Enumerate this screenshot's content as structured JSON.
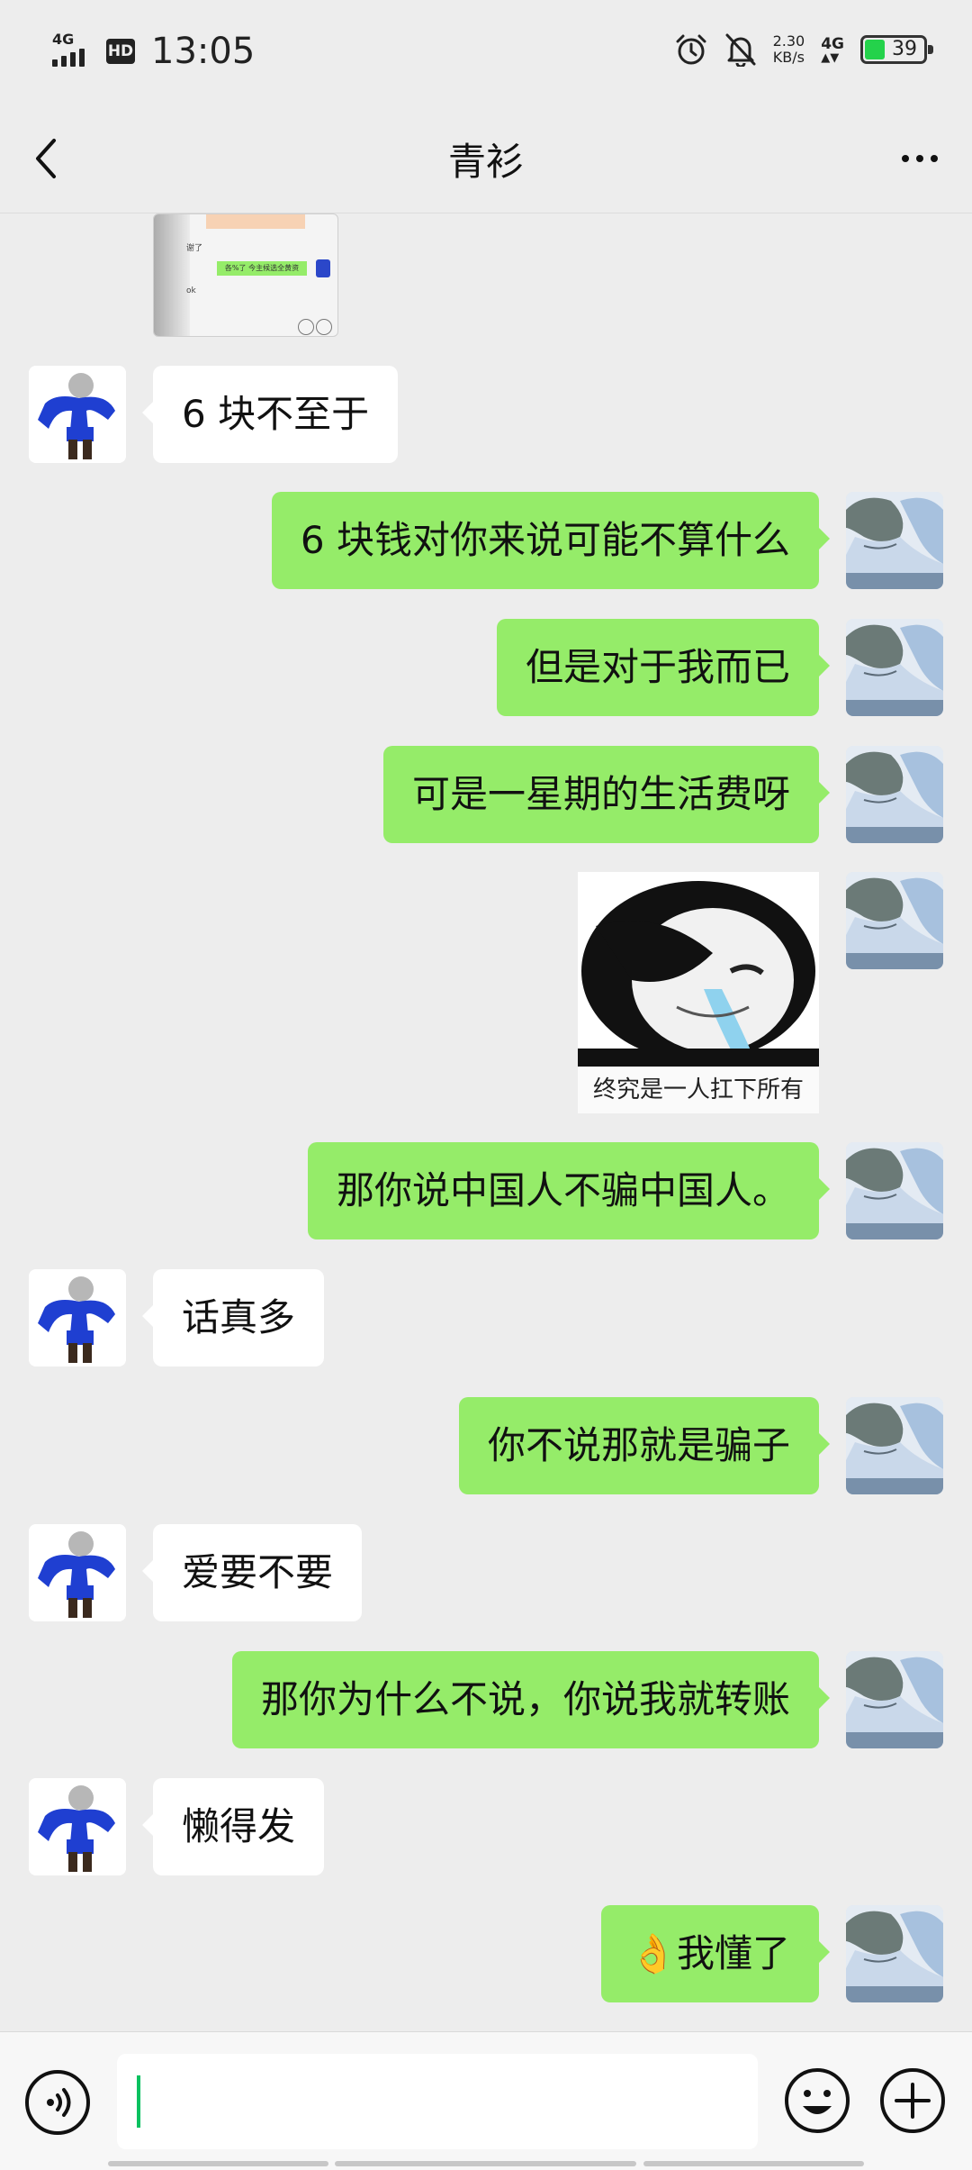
{
  "status_bar": {
    "network": "4G",
    "hd": "HD",
    "time": "13:05",
    "speed_value": "2.30",
    "speed_unit": "KB/s",
    "network_right": "4G",
    "battery": "39",
    "battery_level": 0.39
  },
  "nav": {
    "title": "青衫"
  },
  "messages": [
    {
      "side": "left",
      "text": "6 块不至于"
    },
    {
      "side": "right",
      "text": "6 块钱对你来说可能不算什么"
    },
    {
      "side": "right",
      "text": "但是对于我而已"
    },
    {
      "side": "right",
      "text": "可是一星期的生活费呀"
    },
    {
      "side": "right",
      "type": "sticker",
      "caption": "终究是一人扛下所有"
    },
    {
      "side": "right",
      "text": "那你说中国人不骗中国人。"
    },
    {
      "side": "left",
      "text": "话真多"
    },
    {
      "side": "right",
      "text": "你不说那就是骗子"
    },
    {
      "side": "left",
      "text": "爱要不要"
    },
    {
      "side": "right",
      "text": "那你为什么不说，你说我就转账"
    },
    {
      "side": "left",
      "text": "懒得发"
    },
    {
      "side": "right",
      "text": "👌我懂了"
    }
  ],
  "thumb": {
    "line1": "谢了",
    "line2": "各%了 今主候选全黄资",
    "line3": "ok"
  },
  "input": {
    "value": ""
  },
  "colors": {
    "background": "#ededed",
    "bubble_self": "#95ec69",
    "bubble_other": "#ffffff",
    "accent": "#07c160"
  },
  "icons": {
    "back": "chevron-left-icon",
    "more": "more-dots-icon",
    "voice": "voice-icon",
    "emoji": "emoji-icon",
    "plus": "plus-icon"
  }
}
